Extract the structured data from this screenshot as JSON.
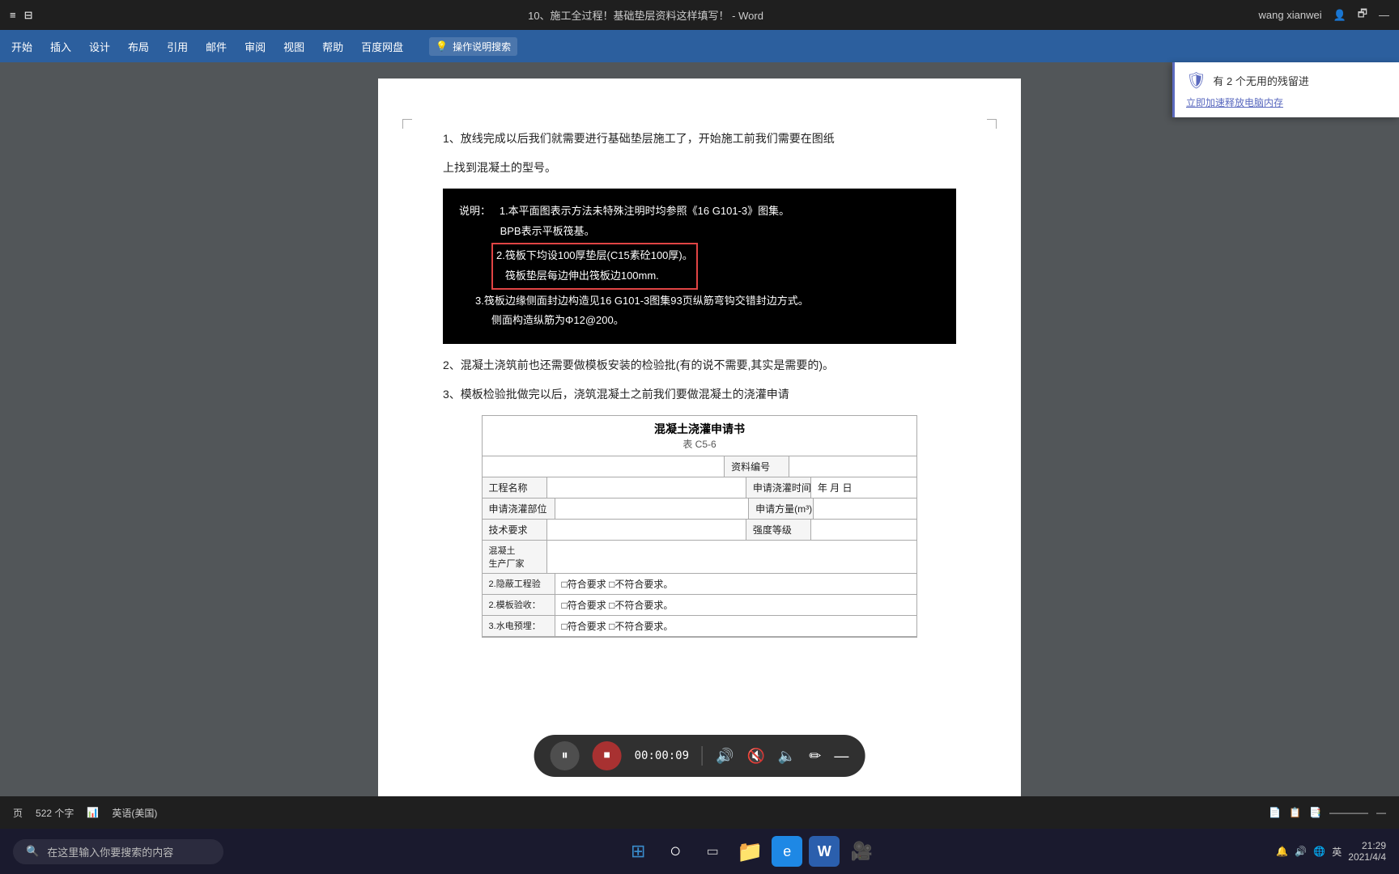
{
  "titlebar": {
    "title": "10、施工全过程！基础垫层资料这样填写！ - Word",
    "user": "wang xianwei",
    "restore_icon": "🗗",
    "minimize_icon": "—",
    "system_icon": "⊟",
    "window_icon": "≡"
  },
  "menubar": {
    "items": [
      "开始",
      "插入",
      "设计",
      "布局",
      "引用",
      "邮件",
      "审阅",
      "视图",
      "帮助",
      "百度网盘"
    ],
    "search_placeholder": "操作说明搜索",
    "search_icon": "💡"
  },
  "document": {
    "paragraph1": "1、放线完成以后我们就需要进行基础垫层施工了，开始施工前我们需要在图纸",
    "paragraph1b": "上找到混凝土的型号。",
    "image_lines": [
      "说明：   1.本平面图表示方法未特殊注明时均参照《16 G101-3》图集。",
      "              BPB表示平板筏基。",
      "           2.筏板下均设100厚垫层(C15素砼100厚)。",
      "              筏板垫层每边伸出筏板边100mm.",
      "           3.筏板边缘侧面封边构造见16 G101-3图集93页纵筋弯钩交错封边方式。",
      "              侧面构造纵筋为Φ12@200。"
    ],
    "highlight_text": "2.筏板下均设100厚垫层(C15素砼100厚)。\n              筏板垫层每边伸出筏板边100mm.",
    "paragraph2": "2、混凝土浇筑前也还需要做模板安装的检验批(有的说不需要,其实是需要的)。",
    "paragraph3": "3、模板检验批做完以后，浇筑混凝土之前我们要做混凝土的浇灌申请",
    "form": {
      "title": "混凝土浇灌申请书",
      "subtitle": "表 C5-6",
      "resource_number_label": "资料编号",
      "rows": [
        {
          "label": "工程名称",
          "value": "",
          "label2": "申请浇灌时间",
          "value2": "年  月  日"
        },
        {
          "label": "申请浇灌部位",
          "value": "",
          "label2": "申请方量(m³)",
          "value2": ""
        },
        {
          "label": "技术要求",
          "value": "",
          "label2": "强度等级",
          "value2": ""
        },
        {
          "label": "混凝土\n生产厂家",
          "value": "",
          "label2": "",
          "value2": ""
        },
        {
          "label": "2.隐蔽工程验",
          "value": "□符合要求  □不符合要求。",
          "label2": "",
          "value2": ""
        },
        {
          "label": "2.模板验收：",
          "value": "□符合要求  □不符合要求。",
          "label2": "",
          "value2": ""
        },
        {
          "label": "3.水电预埋：",
          "value": "□符合要求  □不符合要求。",
          "label2": "",
          "value2": ""
        }
      ]
    }
  },
  "video_controls": {
    "pause_icon": "⏸",
    "stop_icon": "⏹",
    "time": "00:00:09",
    "volume_icon": "🔊",
    "mute_icon": "🔇",
    "speed_icon": "🔈",
    "pen_icon": "✏",
    "minus_icon": "—"
  },
  "statusbar": {
    "page_info": "页",
    "word_count": "522 个字",
    "track_icon": "📊",
    "language": "英语(美国)",
    "view_icons": [
      "📄",
      "📋",
      "📑"
    ],
    "zoom": "—"
  },
  "notification": {
    "icon": "🛡",
    "text": "有 2 个无用的残留进",
    "link_text": "立即加速释放电脑内存"
  },
  "taskbar": {
    "search_placeholder": "在这里输入你要搜索的内容",
    "search_icon": "🔍",
    "icons": [
      {
        "name": "windows",
        "symbol": "⊞",
        "color": "#3a8ccc"
      },
      {
        "name": "cortana",
        "symbol": "○",
        "color": "#fff"
      },
      {
        "name": "taskview",
        "symbol": "▭",
        "color": "#fff"
      },
      {
        "name": "explorer",
        "symbol": "📁",
        "color": "#f0c040"
      },
      {
        "name": "edge",
        "symbol": "🌐",
        "color": "#3b9ee8"
      },
      {
        "name": "word",
        "symbol": "W",
        "color": "#2b5fad",
        "bg": "#fff"
      },
      {
        "name": "camera",
        "symbol": "🎥",
        "color": "#555"
      }
    ],
    "time": "21:29",
    "date": "2021/4/4",
    "sys_icons": [
      "🔔",
      "🔊",
      "🌐",
      "英"
    ]
  }
}
